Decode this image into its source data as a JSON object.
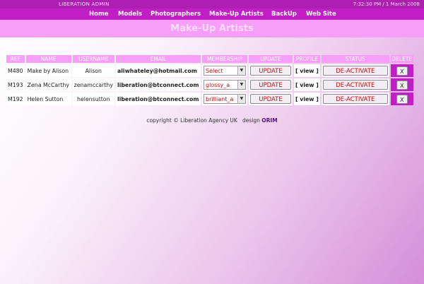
{
  "topbar": {
    "app_name": "LIBERATION ADMIN",
    "datetime": "7:32:30 PM / 1 March 2008"
  },
  "nav": [
    "Home",
    "Models",
    "Photographers",
    "Make-Up Artists",
    "BackUp",
    "Web Site"
  ],
  "page": {
    "title": "Make-Up Artists"
  },
  "table": {
    "headers": [
      "REF",
      "NAME",
      "USERNAME",
      "EMAIL",
      "MEMBERSHIP",
      "UPDATE",
      "PROFILE",
      "STATUS",
      "DELETE"
    ],
    "rows": [
      {
        "ref": "M480",
        "name": "Make by Alison",
        "username": "Alison",
        "email": "aliwhateley@hotmail.com",
        "membership": "Select",
        "update": "UPDATE",
        "profile": "[ view ]",
        "status": "DE-ACTIVATE",
        "delete": "X"
      },
      {
        "ref": "M193",
        "name": "Zena McCarthy",
        "username": "zenamccarthy",
        "email": "liberation@btconnect.com",
        "membership": "glossy_a",
        "update": "UPDATE",
        "profile": "[ view ]",
        "status": "DE-ACTIVATE",
        "delete": "X"
      },
      {
        "ref": "M192",
        "name": "Helen Sutton",
        "username": "helensutton",
        "email": "liberation@btconnect.com",
        "membership": "brilliant_a",
        "update": "UPDATE",
        "profile": "[ view ]",
        "status": "DE-ACTIVATE",
        "delete": "X"
      }
    ]
  },
  "footer": {
    "copyright": "copyright © Liberation Agency UK",
    "design_label": "design",
    "designer": "ORIM"
  },
  "colors": {
    "topbar": "#ad1fb0",
    "navbar": "#c21ec5",
    "heading": "#f79ef8",
    "button_text": "#c01010"
  }
}
